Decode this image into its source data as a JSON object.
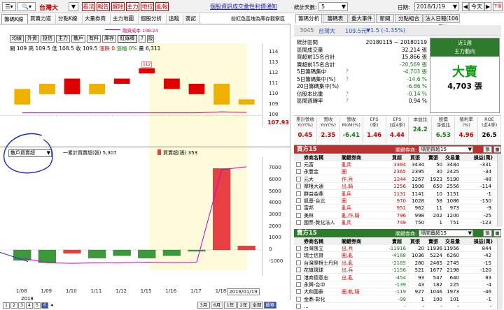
{
  "topbar": {
    "stock": "台灣大",
    "buttons": [
      "看法",
      "報告",
      "醒除",
      "主力",
      "地拉",
      "亂報"
    ],
    "links": [
      "個股資訊",
      "成交彙性",
      "利價通知"
    ],
    "period_label": "統計天數:",
    "period_value": "5",
    "date_label": "日期:",
    "date_value": "2018/1/19",
    "today_btn": "今天",
    "trade_btn": "下單"
  },
  "left_tabs": [
    "籌碼K線",
    "買賣力道",
    "分點K線",
    "大量券商",
    "主力地圖",
    "個股分析",
    "追蹤",
    "簽記"
  ],
  "chart_note": "前紅色區塊為庫存觀察區",
  "toolbar": [
    "均線",
    "外資",
    "投信",
    "主力",
    "散戶",
    "有料",
    "庫存",
    "紅綠棒",
    "?",
    "設"
  ],
  "legend_cost": "融資成本 108.24",
  "ohlc": {
    "open": "開 109",
    "high": "高 109.5",
    "low": "低 108.5",
    "close": "收 109.5",
    "chg": "漲跌 0",
    "pct": "漲幅 0%",
    "vol": "量 6,311"
  },
  "price_ticks": [
    "114",
    "113",
    "112",
    "111",
    "110",
    "109",
    "108"
  ],
  "price_marker": "107.93",
  "candle_label": "112",
  "lower_select": "散戶買賣超",
  "lower_legend_1": "一累計買賣超(張) 5,307",
  "lower_legend_2": "買賣超(張) 353",
  "vol_ticks": [
    "7000",
    "6000",
    "5000",
    "4000",
    "3000",
    "2000",
    "1000",
    "0",
    "-1000"
  ],
  "dates": [
    "1/08",
    "1/09",
    "1/10",
    "1/11",
    "1/12",
    "1/15",
    "1/16",
    "1/17",
    "1/18",
    "2018/01/19"
  ],
  "year": "2018",
  "pages": [
    "1",
    "2",
    "3",
    "4",
    "5",
    "6"
  ],
  "bottom_btns": [
    "3月",
    "6月",
    "1年",
    "2年",
    "全部",
    "觀察"
  ],
  "right_tabs": [
    "籌碼分析",
    "籌碼表",
    "重大事件",
    "新聞",
    "分點組合",
    "法人日報(106年)"
  ],
  "quote": {
    "code": "3045",
    "name": "台灣大",
    "price": "109.5元",
    "chg": "▼1.5 (-1.35%)"
  },
  "stats": [
    {
      "label": "統計區間",
      "value": "20180115 ~ 20180119",
      "info": ""
    },
    {
      "label": "區間成交量",
      "value": "32,214 張",
      "info": ""
    },
    {
      "label": "買超前15名合計",
      "value": "15,866 張",
      "info": ""
    },
    {
      "label": "賣超前15名合計",
      "value": "-20,569 張",
      "info": ""
    },
    {
      "label": "5日籌碼集中",
      "value": "-4,703 張",
      "info": "?"
    },
    {
      "label": "5日籌碼集中(%)",
      "value": "-14.6 %",
      "info": "?"
    },
    {
      "label": "20日籌碼集中(%)",
      "value": "-6.86 %",
      "info": ""
    },
    {
      "label": "佔股本比重",
      "value": "-0.14 %",
      "info": "?"
    },
    {
      "label": "區間週轉率",
      "value": "0.94 %",
      "info": "?"
    }
  ],
  "trend_box": {
    "title1": "近1週",
    "title2": "主力動向",
    "signal": "大賣",
    "amount": "4,703 張"
  },
  "metrics": [
    {
      "h1": "累計營收",
      "h2": "YoY(%)",
      "v": "0.45",
      "color": "#c00"
    },
    {
      "h1": "營收",
      "h2": "YoY(%)",
      "v": "2.35",
      "color": "#c00"
    },
    {
      "h1": "營收",
      "h2": "MoM(%)",
      "v": "-6.41",
      "color": "#1a7a1a"
    },
    {
      "h1": "EPS",
      "h2": "(季)",
      "v": "1.46",
      "color": "#c00"
    },
    {
      "h1": "EPS",
      "h2": "(近4季)",
      "v": "4.44",
      "color": "#c00"
    },
    {
      "h1": "本益比",
      "h2": "",
      "v": "24.2",
      "color": "#1a7a1a"
    },
    {
      "h1": "股價",
      "h2": "淨值比",
      "v": "6.53",
      "color": "#1a7a1a"
    },
    {
      "h1": "殖利率",
      "h2": "(%)",
      "v": "4.96",
      "color": "#c00"
    },
    {
      "h1": "ROE",
      "h2": "(近4季)",
      "v": "26.5",
      "color": "#000"
    }
  ],
  "buy": {
    "title": "買方15",
    "filter_label": "關鍵券商:",
    "filter_value": "隔間買超15",
    "btn1": "鎖",
    "cols": [
      "券商名稱",
      "關鍵券商",
      "買超",
      "買張",
      "賣張",
      "交易量",
      "損益(萬)"
    ],
    "rows": [
      [
        "元富",
        "亂兵",
        "3384",
        "3434",
        "50",
        "3484",
        "-331"
      ],
      [
        "永豐金",
        "圈",
        "2365",
        "2395",
        "30",
        "2425",
        "-34"
      ],
      [
        "元大",
        "作,兵",
        "1344",
        "3267",
        "1923",
        "5190",
        "-48"
      ],
      [
        "摩根大通",
        "出,騎",
        "1256",
        "1906",
        "650",
        "2556",
        "-114"
      ],
      [
        "群益金鼎",
        "亂兵",
        "1131",
        "1141",
        "10",
        "1151",
        "-1"
      ],
      [
        "凱基-台北",
        "圈",
        "970",
        "1028",
        "58",
        "1086",
        "-150"
      ],
      [
        "富邦",
        "亂兵",
        "951",
        "962",
        "11",
        "973",
        "-9"
      ],
      [
        "美林",
        "亂,作,騎",
        "796",
        "998",
        "202",
        "1200",
        "-25"
      ],
      [
        "國票-敦化法人",
        "亂兵",
        "749",
        "750",
        "1",
        "751",
        "-123"
      ]
    ]
  },
  "sell": {
    "title": "賣方15",
    "filter_label": "關鍵券商:",
    "filter_value": "隔間賣超15",
    "btn1": "鎖",
    "cols": [
      "券商名稱",
      "關鍵券商",
      "賣超",
      "買張",
      "賣張",
      "交易量",
      "損益(萬)"
    ],
    "rows": [
      [
        "台灣匯立",
        "出,兵",
        "-11916",
        "20",
        "11936",
        "11956",
        "844"
      ],
      [
        "瑞士信貸",
        "圈,亂",
        "-4188",
        "1036",
        "5224",
        "6260",
        "-42"
      ],
      [
        "台灣摩根士丹利",
        "出,亂",
        "-2185",
        "280",
        "2465",
        "2745",
        "-15"
      ],
      [
        "花旗環球",
        "出,兵",
        "-1156",
        "521",
        "1677",
        "2198",
        "-120"
      ],
      [
        "港商德意志",
        "出,亂",
        "-454",
        "93",
        "547",
        "640",
        "83"
      ],
      [
        "永興-台中",
        "",
        "-139",
        "43",
        "182",
        "225",
        "-4"
      ],
      [
        "大和國泰",
        "圈,軌,騎",
        "-119",
        "927",
        "1046",
        "1973",
        "-46"
      ],
      [
        "金鼎-彰化",
        "",
        "-99",
        "1",
        "100",
        "101",
        "-1"
      ],
      [
        "...",
        "",
        "-",
        "-",
        "-",
        "-",
        "-"
      ]
    ]
  },
  "chart_data": [
    {
      "type": "candlestick",
      "dates": [
        "1/08",
        "1/09",
        "1/10",
        "1/11",
        "1/12",
        "1/15",
        "1/16",
        "1/17",
        "1/18",
        "1/19"
      ],
      "open": [
        110.5,
        111,
        110,
        111,
        111,
        112,
        111.5,
        111,
        111,
        109
      ],
      "close": [
        109,
        110,
        111.5,
        110,
        111.5,
        112.5,
        110.5,
        110,
        109,
        109.5
      ],
      "high": [
        110.5,
        111,
        111.5,
        111,
        111.5,
        112.5,
        111.5,
        111,
        111,
        109.5
      ],
      "low": [
        109,
        110,
        110,
        110,
        111,
        112,
        110.5,
        110,
        109,
        108.5
      ],
      "color": [
        "#f0b000",
        "#f0b000",
        "#e00000",
        "#f0b000",
        "#e00000",
        "#e00000",
        "#e00000",
        "#e00000",
        "#f0b000",
        "#f0b000"
      ],
      "ylim": [
        107.5,
        114.5
      ],
      "ma_line": [
        108.2,
        108.2,
        108.2,
        108.2,
        108.2,
        108.2,
        108.2,
        108.2,
        108.3,
        108.24
      ]
    },
    {
      "type": "bar",
      "categories": [
        "1/08",
        "1/09",
        "1/10",
        "1/11",
        "1/12",
        "1/15",
        "1/16",
        "1/17",
        "1/18",
        "1/19"
      ],
      "values": [
        -900,
        -1100,
        -300,
        -700,
        -500,
        -700,
        -500,
        -100,
        7000,
        353
      ],
      "bar_colors": [
        "#3a9a3a",
        "#3a9a3a",
        "#e84040",
        "#3a9a3a",
        "#3a9a3a",
        "#3a9a3a",
        "#3a9a3a",
        "#3a9a3a",
        "#e84040",
        "#e84040"
      ],
      "cumulative": [
        -700,
        -1100,
        -1150,
        -1100,
        -1100,
        -1050,
        -1100,
        -1050,
        6900,
        7150
      ],
      "ylim": [
        -1500,
        7500
      ]
    }
  ]
}
